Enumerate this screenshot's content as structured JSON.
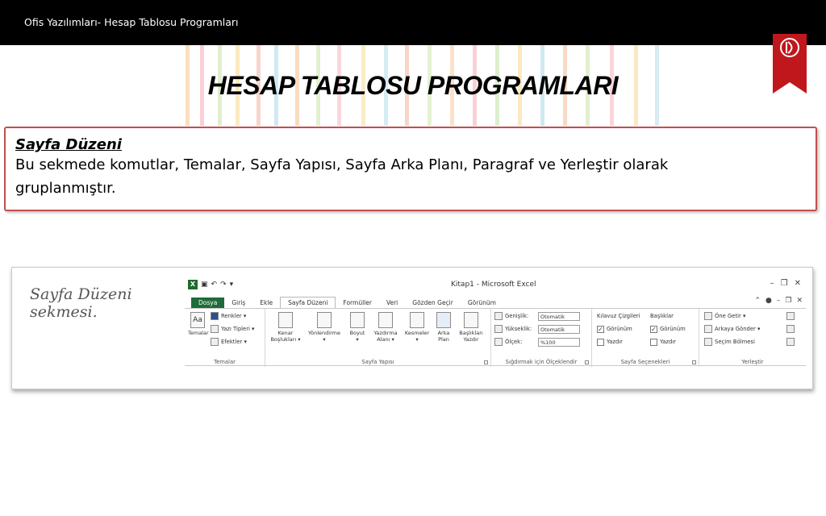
{
  "header": {
    "title": "Ofis Yazılımları- Hesap Tablosu Programları"
  },
  "slide": {
    "title": "HESAP TABLOSU PROGRAMLARI"
  },
  "description": {
    "heading": "Sayfa  Düzeni",
    "line1": "Bu sekmede komutlar, Temalar, Sayfa Yapısı,  Sayfa Arka Planı, Paragraf  ve Yerleştir  olarak",
    "line2": "gruplanmıştır."
  },
  "screenshot": {
    "label_line1": "Sayfa Düzeni",
    "label_line2": "sekmesi.",
    "window_title": "Kitap1  -  Microsoft Excel",
    "tabs": [
      "Dosya",
      "Giriş",
      "Ekle",
      "Sayfa Düzeni",
      "Formüller",
      "Veri",
      "Gözden Geçir",
      "Görünüm"
    ],
    "temalar": {
      "group": "Temalar",
      "big": "Temalar",
      "renkler": "Renkler ▾",
      "yazi_tipleri": "Yazı Tipleri ▾",
      "efektler": "Efektler ▾"
    },
    "sayfa_yapisi": {
      "group": "Sayfa Yapısı",
      "buttons": [
        {
          "line1": "Kenar",
          "line2": "Boşlukları ▾"
        },
        {
          "line1": "Yönlendirme",
          "line2": "▾"
        },
        {
          "line1": "Boyut",
          "line2": "▾"
        },
        {
          "line1": "Yazdırma",
          "line2": "Alanı ▾"
        },
        {
          "line1": "Kesmeler",
          "line2": "▾"
        },
        {
          "line1": "Arka",
          "line2": "Plan"
        },
        {
          "line1": "Başlıkları",
          "line2": "Yazdır"
        }
      ]
    },
    "sigdirmak": {
      "group": "Sığdırmak için Ölçeklendir",
      "genislik_label": "Genişlik:",
      "genislik_value": "Otomatik",
      "yukseklik_label": "Yükseklik:",
      "yukseklik_value": "Otomatik",
      "olcek_label": "Ölçek:",
      "olcek_value": "%100"
    },
    "sayfa_secenekleri": {
      "group": "Sayfa Seçenekleri",
      "col1_title": "Kılavuz Çizgileri",
      "col2_title": "Başlıklar",
      "gorunum": "Görünüm",
      "yazdir": "Yazdır"
    },
    "yerlestir": {
      "group": "Yerleştir",
      "one_getir": "Öne Getir ▾",
      "arkaya_gonder": "Arkaya Gönder ▾",
      "secim_bolmesi": "Seçim Bölmesi"
    }
  },
  "colors": {
    "topbar": "#000000",
    "border": "#c0504d",
    "bookmark": "#c0171c",
    "excel_file_tab": "#1f6b3a"
  }
}
